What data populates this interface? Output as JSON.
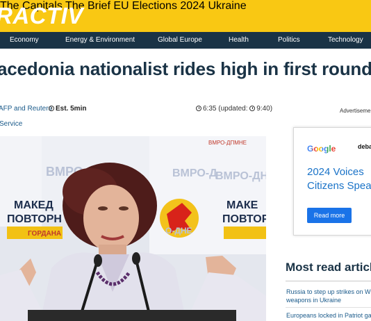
{
  "brand": {
    "logo_text": "RACTIV"
  },
  "top_nav": [
    "The Capitals",
    "The Brief",
    "EU Elections 2024",
    "Ukraine"
  ],
  "section_nav": [
    "Economy",
    "Energy & Environment",
    "Global Europe",
    "Health",
    "Politics",
    "Technology"
  ],
  "article": {
    "headline": "acedonia nationalist rides high in first round of presid",
    "source": "AFP and Reuters",
    "read_time": "Est. 5min",
    "time": "6:35 (updated:",
    "time_updated": "9:40)",
    "service": "Service"
  },
  "sidebar": {
    "advert_label": "Advertisement",
    "ad": {
      "google": "Google",
      "partner": "deba",
      "line1": "2024 Voices",
      "line2": "Citizens Spea",
      "button": "Read more"
    },
    "most_read": {
      "title": "Most read articles",
      "items": [
        "Russia to step up strikes on W weapons in Ukraine",
        "Europeans locked in Patriot ga"
      ]
    }
  },
  "colors": {
    "brand_yellow": "#f9c813",
    "nav_dark": "#1a3346",
    "link_blue": "#1a5a8a"
  }
}
